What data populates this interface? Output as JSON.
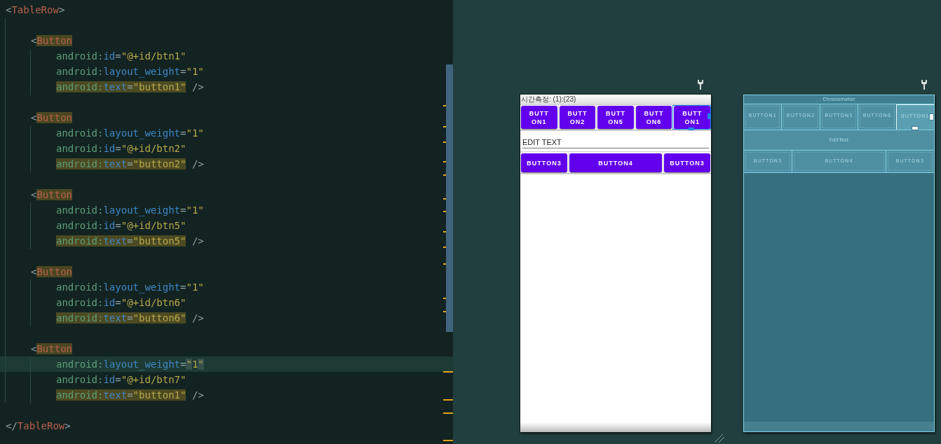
{
  "editor": {
    "code": {
      "open_tag": {
        "lt": "<",
        "name": "TableRow",
        "gt": ">"
      },
      "close_tag": {
        "lt": "</",
        "name": "TableRow",
        "gt": ">"
      },
      "children": [
        {
          "lt": "<",
          "name": "Button",
          "name_highlighted": true,
          "end": "/>",
          "attributes": [
            {
              "prefix": "android:",
              "name": "id",
              "eq": "=",
              "value": "\"@+id/btn1\"",
              "highlighted": false,
              "current": false
            },
            {
              "prefix": "android:",
              "name": "layout_weight",
              "eq": "=",
              "value": "\"1\"",
              "highlighted": false,
              "current": false
            },
            {
              "prefix": "android:",
              "name": "text",
              "eq": "=",
              "value": "\"button1\"",
              "highlighted": true,
              "current": false
            }
          ]
        },
        {
          "lt": "<",
          "name": "Button",
          "name_highlighted": true,
          "end": "/>",
          "attributes": [
            {
              "prefix": "android:",
              "name": "layout_weight",
              "eq": "=",
              "value": "\"1\"",
              "highlighted": false,
              "current": false
            },
            {
              "prefix": "android:",
              "name": "id",
              "eq": "=",
              "value": "\"@+id/btn2\"",
              "highlighted": false,
              "current": false
            },
            {
              "prefix": "android:",
              "name": "text",
              "eq": "=",
              "value": "\"button2\"",
              "highlighted": true,
              "current": false
            }
          ]
        },
        {
          "lt": "<",
          "name": "Button",
          "name_highlighted": true,
          "end": "/>",
          "attributes": [
            {
              "prefix": "android:",
              "name": "layout_weight",
              "eq": "=",
              "value": "\"1\"",
              "highlighted": false,
              "current": false
            },
            {
              "prefix": "android:",
              "name": "id",
              "eq": "=",
              "value": "\"@+id/btn5\"",
              "highlighted": false,
              "current": false
            },
            {
              "prefix": "android:",
              "name": "text",
              "eq": "=",
              "value": "\"button5\"",
              "highlighted": true,
              "current": false
            }
          ]
        },
        {
          "lt": "<",
          "name": "Button",
          "name_highlighted": true,
          "end": "/>",
          "attributes": [
            {
              "prefix": "android:",
              "name": "layout_weight",
              "eq": "=",
              "value": "\"1\"",
              "highlighted": false,
              "current": false
            },
            {
              "prefix": "android:",
              "name": "id",
              "eq": "=",
              "value": "\"@+id/btn6\"",
              "highlighted": false,
              "current": false
            },
            {
              "prefix": "android:",
              "name": "text",
              "eq": "=",
              "value": "\"button6\"",
              "highlighted": true,
              "current": false
            }
          ]
        },
        {
          "lt": "<",
          "name": "Button",
          "name_highlighted": true,
          "end": "/>",
          "attributes": [
            {
              "prefix": "android:",
              "name": "layout_weight",
              "eq": "=",
              "value": "\"1\"",
              "highlighted": false,
              "current": true
            },
            {
              "prefix": "android:",
              "name": "id",
              "eq": "=",
              "value": "\"@+id/btn7\"",
              "highlighted": false,
              "current": false
            },
            {
              "prefix": "android:",
              "name": "text",
              "eq": "=",
              "value": "\"button1\"",
              "highlighted": true,
              "current": false
            }
          ]
        }
      ]
    }
  },
  "design": {
    "preview": {
      "chronometer": "시간측정: (1):(23)",
      "button_row": [
        {
          "label": "BUTTON1",
          "selected": false
        },
        {
          "label": "BUTTON2",
          "selected": false
        },
        {
          "label": "BUTTON5",
          "selected": false
        },
        {
          "label": "BUTTON6",
          "selected": false
        },
        {
          "label": "BUTTON1",
          "selected": true
        }
      ],
      "edit_text": {
        "value": "EDIT TEXT"
      },
      "button_row_2": [
        {
          "label": "BUTTON3",
          "selected": false
        },
        {
          "label": "BUTTON4",
          "selected": false
        },
        {
          "label": "BUTTON3",
          "selected": false
        }
      ]
    },
    "blueprint": {
      "chronometer": "Chronometer",
      "button_row": [
        {
          "label": "BUTTON1",
          "selected": false
        },
        {
          "label": "BUTTON2",
          "selected": false
        },
        {
          "label": "BUTTON5",
          "selected": false
        },
        {
          "label": "BUTTON6",
          "selected": false
        },
        {
          "label": "BUTTON1",
          "selected": true
        }
      ],
      "edit_text": {
        "value": "EditText"
      },
      "button_row_2": [
        {
          "label": "BUTTON3",
          "selected": false
        },
        {
          "label": "BUTTON4",
          "selected": false
        },
        {
          "label": "BUTTON3",
          "selected": false
        }
      ]
    }
  }
}
